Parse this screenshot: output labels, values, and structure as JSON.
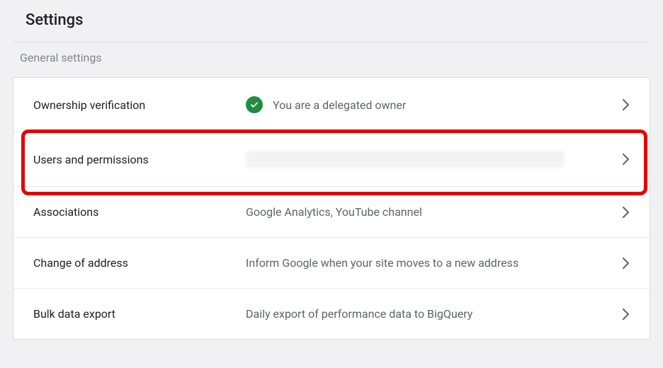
{
  "page": {
    "title": "Settings",
    "section_header": "General settings"
  },
  "rows": [
    {
      "label": "Ownership verification",
      "value": "You are a delegated owner",
      "has_check_icon": true
    },
    {
      "label": "Users and permissions",
      "value": "",
      "blurred": true,
      "highlighted": true
    },
    {
      "label": "Associations",
      "value": "Google Analytics, YouTube channel"
    },
    {
      "label": "Change of address",
      "value": "Inform Google when your site moves to a new address"
    },
    {
      "label": "Bulk data export",
      "value": "Daily export of performance data to BigQuery"
    }
  ],
  "colors": {
    "highlight_border": "#e60000",
    "check_green": "#1e8e3e"
  }
}
